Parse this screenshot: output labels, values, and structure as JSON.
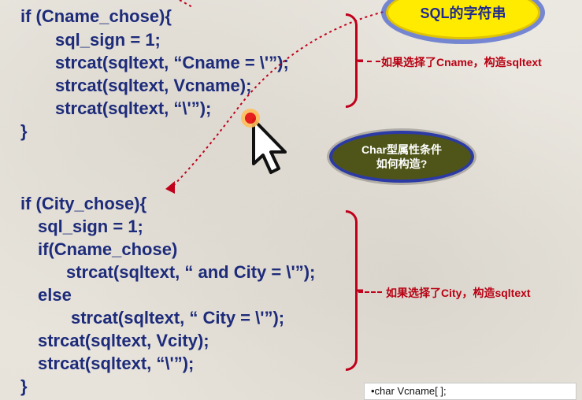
{
  "code": {
    "block1": {
      "line1": "if (Cname_chose){",
      "line2": "sql_sign = 1;",
      "line3": "strcat(sqltext, “Cname = \\'”);",
      "line4": "strcat(sqltext, Vcname);",
      "line5": "strcat(sqltext, “\\'”);",
      "line6": "}"
    },
    "block2": {
      "line1": "if (City_chose){",
      "line2": "sql_sign = 1;",
      "line3": "if(Cname_chose)",
      "line4": "strcat(sqltext, “ and City = \\'”);",
      "line5": "else",
      "line6": "strcat(sqltext, “ City = \\'”);",
      "line7": "strcat(sqltext, Vcity);",
      "line8": "strcat(sqltext, “\\'”);",
      "line9": "}"
    }
  },
  "annotations": {
    "bubble_sql": "SQL的字符串",
    "note_cname": "如果选择了Cname，构造sqltext",
    "bubble_char_line1": "Char型属性条件",
    "bubble_char_line2": "如何构造?",
    "note_city": "如果选择了City，构造sqltext"
  },
  "box": {
    "text": "•char  Vcname[ ];"
  },
  "colors": {
    "code": "#1d2b7a",
    "annotation_red": "#c0001a",
    "bubble_yellow": "#ffeb00",
    "bubble_olive": "#4f5518"
  },
  "icons": {
    "cursor": "arrow-cursor-icon"
  }
}
